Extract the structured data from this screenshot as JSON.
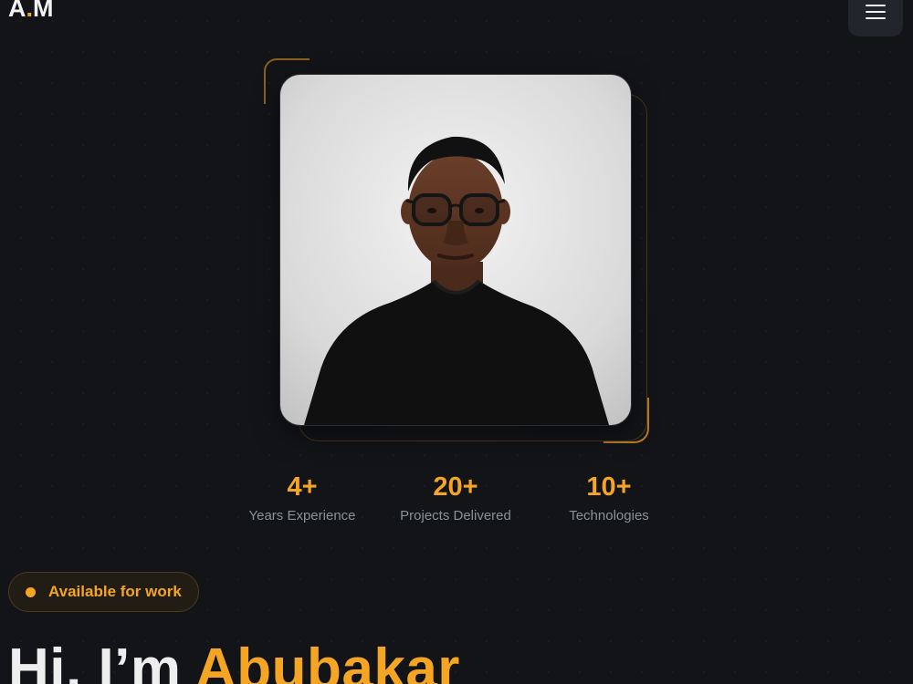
{
  "header": {
    "logo_left": "A",
    "logo_dot": ".",
    "logo_right": "M",
    "menu_icon": "hamburger-menu-icon"
  },
  "hero": {
    "photo_icon": "profile-portrait",
    "stats": [
      {
        "value": "4+",
        "label": "Years Experience"
      },
      {
        "value": "20+",
        "label": "Projects Delivered"
      },
      {
        "value": "10+",
        "label": "Technologies"
      }
    ],
    "badge": "Available for work",
    "greeting": "Hi, I’m",
    "name": "Abubakar"
  },
  "colors": {
    "accent": "#f5a524",
    "background": "#121418",
    "text": "#eeeeee",
    "muted": "#8b9099"
  }
}
